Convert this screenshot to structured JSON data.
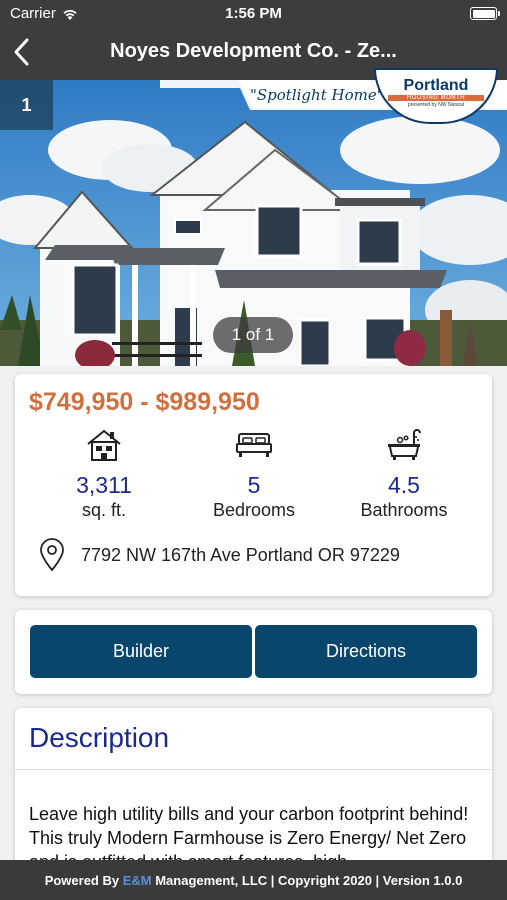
{
  "status": {
    "carrier": "Carrier",
    "time": "1:56 PM"
  },
  "nav": {
    "title": "Noyes Development Co. - Ze..."
  },
  "hero": {
    "photo_index": "1",
    "counter": "1 of 1",
    "banner_text": "\"Spotlight Home\"",
    "badge_title": "Portland",
    "badge_subtitle": "HOUSING MONTH",
    "badge_sponsor": "presented by NW Natural"
  },
  "summary": {
    "price": "$749,950 - $989,950",
    "stats": [
      {
        "icon": "house-icon",
        "value": "3,311",
        "label": "sq. ft."
      },
      {
        "icon": "bed-icon",
        "value": "5",
        "label": "Bedrooms"
      },
      {
        "icon": "bathtub-icon",
        "value": "4.5",
        "label": "Bathrooms"
      }
    ],
    "address": "7792 NW 167th Ave Portland OR 97229"
  },
  "actions": {
    "builder": "Builder",
    "directions": "Directions"
  },
  "description": {
    "title": "Description",
    "text": "Leave high utility bills and your carbon footprint behind! This truly Modern Farmhouse is Zero Energy/ Net Zero and is outfitted with smart features, high-"
  },
  "footer": {
    "prefix": "Powered By ",
    "brand": "E&M",
    "suffix": " Management, LLC | Copyright 2020 | Version 1.0.0"
  },
  "colors": {
    "price": "#d0703f",
    "accent_blue": "#1a2a8c",
    "button": "#08476b",
    "bar": "#3d3d3f"
  }
}
